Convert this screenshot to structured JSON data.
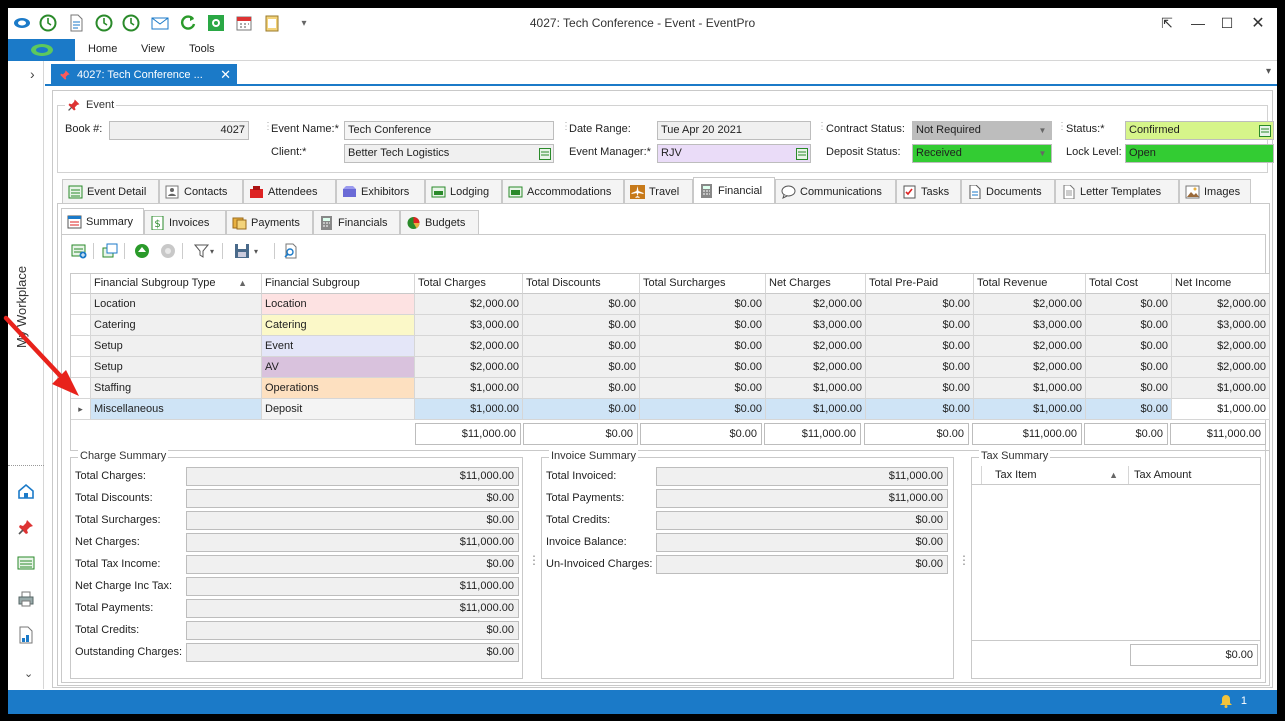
{
  "window": {
    "title": "4027: Tech Conference - Event - EventPro",
    "ribbon_tabs": [
      "Home",
      "View",
      "Tools"
    ]
  },
  "left_bar": {
    "label": "My Workplace",
    "icons": [
      "home-icon",
      "pin-icon",
      "list-icon",
      "printer-icon",
      "report-icon"
    ]
  },
  "doc_tab": {
    "label": "4027: Tech Conference ..."
  },
  "event": {
    "group_title": "Event",
    "book_label": "Book #:",
    "book_value": "4027",
    "event_name_label": "Event Name:*",
    "event_name_value": "Tech Conference",
    "client_label": "Client:*",
    "client_value": "Better Tech Logistics",
    "date_range_label": "Date Range:",
    "date_range_value": "Tue Apr 20 2021",
    "event_manager_label": "Event Manager:*",
    "event_manager_value": "RJV",
    "contract_status_label": "Contract Status:",
    "contract_status_value": "Not Required",
    "deposit_status_label": "Deposit Status:",
    "deposit_status_value": "Received",
    "status_label": "Status:*",
    "status_value": "Confirmed",
    "lock_level_label": "Lock Level:",
    "lock_level_value": "Open"
  },
  "main_tabs": [
    "Event Detail",
    "Contacts",
    "Attendees",
    "Exhibitors",
    "Lodging",
    "Accommodations",
    "Travel",
    "Financial",
    "Communications",
    "Tasks",
    "Documents",
    "Letter Templates",
    "Images"
  ],
  "sub_tabs": [
    "Summary",
    "Invoices",
    "Payments",
    "Financials",
    "Budgets"
  ],
  "grid": {
    "columns": [
      "Financial Subgroup Type",
      "Financial Subgroup",
      "Total Charges",
      "Total Discounts",
      "Total Surcharges",
      "Net Charges",
      "Total Pre-Paid",
      "Total Revenue",
      "Total Cost",
      "Net Income"
    ],
    "rows": [
      {
        "type": "Location",
        "subgroup": "Location",
        "color": "#fde2e2",
        "cells": [
          "$2,000.00",
          "$0.00",
          "$0.00",
          "$2,000.00",
          "$0.00",
          "$2,000.00",
          "$0.00",
          "$2,000.00"
        ]
      },
      {
        "type": "Catering",
        "subgroup": "Catering",
        "color": "#fbf8c8",
        "cells": [
          "$3,000.00",
          "$0.00",
          "$0.00",
          "$3,000.00",
          "$0.00",
          "$3,000.00",
          "$0.00",
          "$3,000.00"
        ]
      },
      {
        "type": "Setup",
        "subgroup": "Event",
        "color": "#e4e6f8",
        "cells": [
          "$2,000.00",
          "$0.00",
          "$0.00",
          "$2,000.00",
          "$0.00",
          "$2,000.00",
          "$0.00",
          "$2,000.00"
        ]
      },
      {
        "type": "Setup",
        "subgroup": "AV",
        "color": "#d9c2dd",
        "cells": [
          "$2,000.00",
          "$0.00",
          "$0.00",
          "$2,000.00",
          "$0.00",
          "$2,000.00",
          "$0.00",
          "$2,000.00"
        ]
      },
      {
        "type": "Staffing",
        "subgroup": "Operations",
        "color": "#fde0c0",
        "cells": [
          "$1,000.00",
          "$0.00",
          "$0.00",
          "$1,000.00",
          "$0.00",
          "$1,000.00",
          "$0.00",
          "$1,000.00"
        ]
      },
      {
        "type": "Miscellaneous",
        "subgroup": "Deposit",
        "color": "#ffffff",
        "cells": [
          "$1,000.00",
          "$0.00",
          "$0.00",
          "$1,000.00",
          "$0.00",
          "$1,000.00",
          "$0.00",
          "$1,000.00"
        ]
      }
    ],
    "totals": [
      "$11,000.00",
      "$0.00",
      "$0.00",
      "$11,000.00",
      "$0.00",
      "$11,000.00",
      "$0.00",
      "$11,000.00"
    ]
  },
  "charge_summary": {
    "title": "Charge Summary",
    "items": [
      {
        "label": "Total Charges:",
        "value": "$11,000.00"
      },
      {
        "label": "Total Discounts:",
        "value": "$0.00"
      },
      {
        "label": "Total Surcharges:",
        "value": "$0.00"
      },
      {
        "label": "Net Charges:",
        "value": "$11,000.00"
      },
      {
        "label": "Total Tax Income:",
        "value": "$0.00"
      },
      {
        "label": "Net Charge Inc Tax:",
        "value": "$11,000.00"
      },
      {
        "label": "Total Payments:",
        "value": "$11,000.00"
      },
      {
        "label": "Total Credits:",
        "value": "$0.00"
      },
      {
        "label": "Outstanding Charges:",
        "value": "$0.00"
      }
    ]
  },
  "invoice_summary": {
    "title": "Invoice Summary",
    "items": [
      {
        "label": "Total Invoiced:",
        "value": "$11,000.00"
      },
      {
        "label": "Total Payments:",
        "value": "$11,000.00"
      },
      {
        "label": "Total Credits:",
        "value": "$0.00"
      },
      {
        "label": "Invoice Balance:",
        "value": "$0.00"
      },
      {
        "label": "Un-Invoiced Charges:",
        "value": "$0.00"
      }
    ]
  },
  "tax_summary": {
    "title": "Tax Summary",
    "columns": [
      "Tax Item",
      "Tax Amount"
    ],
    "total": "$0.00"
  },
  "status_bar": {
    "notifications": "1"
  }
}
